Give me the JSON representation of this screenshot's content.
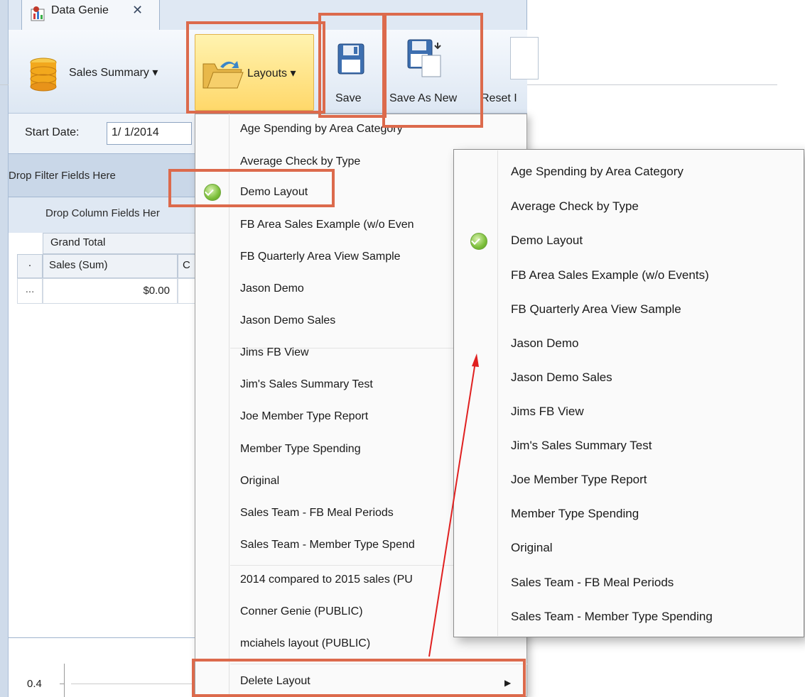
{
  "tab": {
    "title": "Data Genie",
    "close": "✕"
  },
  "ribbon": {
    "sales_summary": "Sales Summary ▾",
    "layouts": "Layouts ▾",
    "save": "Save",
    "save_as_new": "Save As New",
    "reset": "Reset I"
  },
  "filters": {
    "start_date_label": "Start Date:",
    "start_date_value": "1/ 1/2014",
    "drop_filter": "Drop Filter Fields Here",
    "drop_column": "Drop Column Fields Her"
  },
  "grid": {
    "grand_total": "Grand Total",
    "row_header_dot": "·",
    "sales_sum": "Sales (Sum)",
    "col_c": "C",
    "row_header_ellipsis": "...",
    "sales_value": "$0.00"
  },
  "chart": {
    "tick": "0.4"
  },
  "menu": {
    "items": [
      "Age Spending by Area Category",
      "Average Check  by Type",
      "Demo Layout",
      "FB Area Sales Example (w/o Even",
      "FB Quarterly Area View Sample",
      "Jason Demo",
      "Jason Demo Sales",
      "Jims FB View",
      "Jim's Sales Summary Test",
      "Joe Member Type Report",
      "Member Type Spending",
      "Original",
      "Sales Team - FB Meal Periods",
      "Sales Team - Member Type Spend",
      "2014 compared to 2015 sales (PU",
      "Conner Genie  (PUBLIC)",
      "mciahels layout (PUBLIC)",
      "Delete Layout"
    ],
    "submenu_arrow": "▶"
  },
  "zoom": {
    "items": [
      "Age Spending by Area Category",
      "Average Check  by Type",
      "Demo Layout",
      "FB Area Sales Example (w/o Events)",
      "FB Quarterly Area View Sample",
      "Jason Demo",
      "Jason Demo Sales",
      "Jims FB View",
      "Jim's Sales Summary Test",
      "Joe Member Type Report",
      "Member Type Spending",
      "Original",
      "Sales Team - FB Meal Periods",
      "Sales Team - Member Type Spending"
    ]
  },
  "colors": {
    "highlight": "#dc6a4c",
    "arrow": "#e02020",
    "checked": "#7cbf3a"
  },
  "icons": [
    "database-icon",
    "folder-open-icon",
    "save-icon",
    "save-as-icon",
    "check-icon"
  ]
}
